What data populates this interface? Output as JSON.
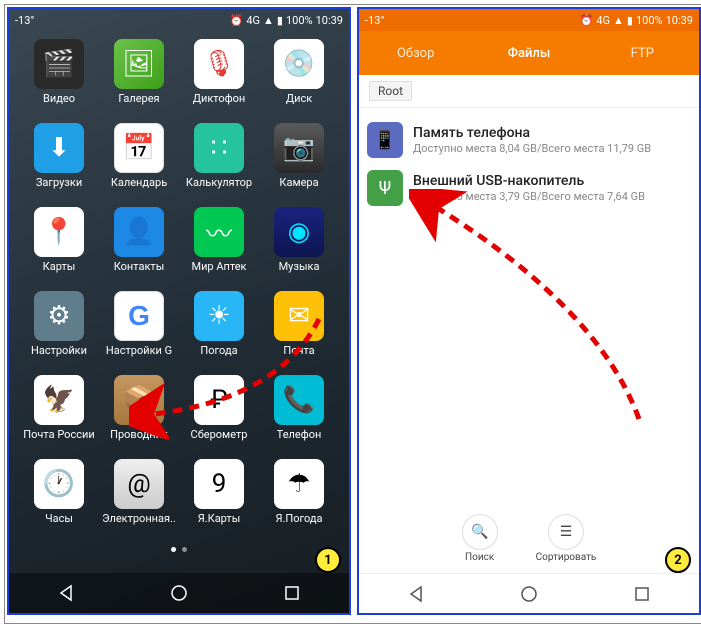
{
  "status": {
    "temperature": "-13°",
    "network": "4G",
    "battery": "100%",
    "time": "10:39"
  },
  "left": {
    "apps": [
      {
        "label": "Видео",
        "cls": "ic-video",
        "glyph": "🎬"
      },
      {
        "label": "Галерея",
        "cls": "ic-gallery",
        "glyph": "🖼"
      },
      {
        "label": "Диктофон",
        "cls": "ic-dict",
        "glyph": "🎙"
      },
      {
        "label": "Диск",
        "cls": "ic-disk",
        "glyph": "💿"
      },
      {
        "label": "Загрузки",
        "cls": "ic-dl",
        "glyph": "⬇"
      },
      {
        "label": "Календарь",
        "cls": "ic-cal",
        "glyph": "📅"
      },
      {
        "label": "Калькулятор",
        "cls": "ic-calc",
        "glyph": "∷"
      },
      {
        "label": "Камера",
        "cls": "ic-cam",
        "glyph": "📷"
      },
      {
        "label": "Карты",
        "cls": "ic-maps",
        "glyph": "📍"
      },
      {
        "label": "Контакты",
        "cls": "ic-cont",
        "glyph": "👤"
      },
      {
        "label": "Мир Аптек",
        "cls": "ic-apt",
        "glyph": "〰"
      },
      {
        "label": "Музыка",
        "cls": "ic-mus",
        "glyph": "◉"
      },
      {
        "label": "Настройки",
        "cls": "ic-sett",
        "glyph": "⚙"
      },
      {
        "label": "Настройки G",
        "cls": "ic-sett2",
        "glyph": "G"
      },
      {
        "label": "Погода",
        "cls": "ic-weather",
        "glyph": "☀"
      },
      {
        "label": "Почта",
        "cls": "ic-mail",
        "glyph": "✉"
      },
      {
        "label": "Почта России",
        "cls": "ic-pochta",
        "glyph": "🦅"
      },
      {
        "label": "Проводник",
        "cls": "ic-expl",
        "glyph": "📦"
      },
      {
        "label": "Сберометр",
        "cls": "ic-sber",
        "glyph": "₽"
      },
      {
        "label": "Телефон",
        "cls": "ic-tel",
        "glyph": "📞"
      },
      {
        "label": "Часы",
        "cls": "ic-clock",
        "glyph": "🕐"
      },
      {
        "label": "Электронная..",
        "cls": "ic-email",
        "glyph": "@"
      },
      {
        "label": "Я.Карты",
        "cls": "ic-ymaps",
        "glyph": "9"
      },
      {
        "label": "Я.Погода",
        "cls": "ic-yw",
        "glyph": "☂"
      }
    ],
    "badge": "1"
  },
  "right": {
    "tabs": {
      "overview": "Обзор",
      "files": "Файлы",
      "ftp": "FTP"
    },
    "breadcrumb": "Root",
    "storage": [
      {
        "title": "Память телефона",
        "sub": "Доступно места 8,04 GB/Всего места 11,79 GB",
        "cls": "phone-ic",
        "glyph": "📱"
      },
      {
        "title": "Внешний USB-накопитель",
        "sub": "Доступно места 3,79 GB/Всего места 7,64 GB",
        "cls": "usb-ic",
        "glyph": "Ψ"
      }
    ],
    "actions": {
      "search": "Поиск",
      "sort": "Сортировать"
    },
    "badge": "2"
  }
}
